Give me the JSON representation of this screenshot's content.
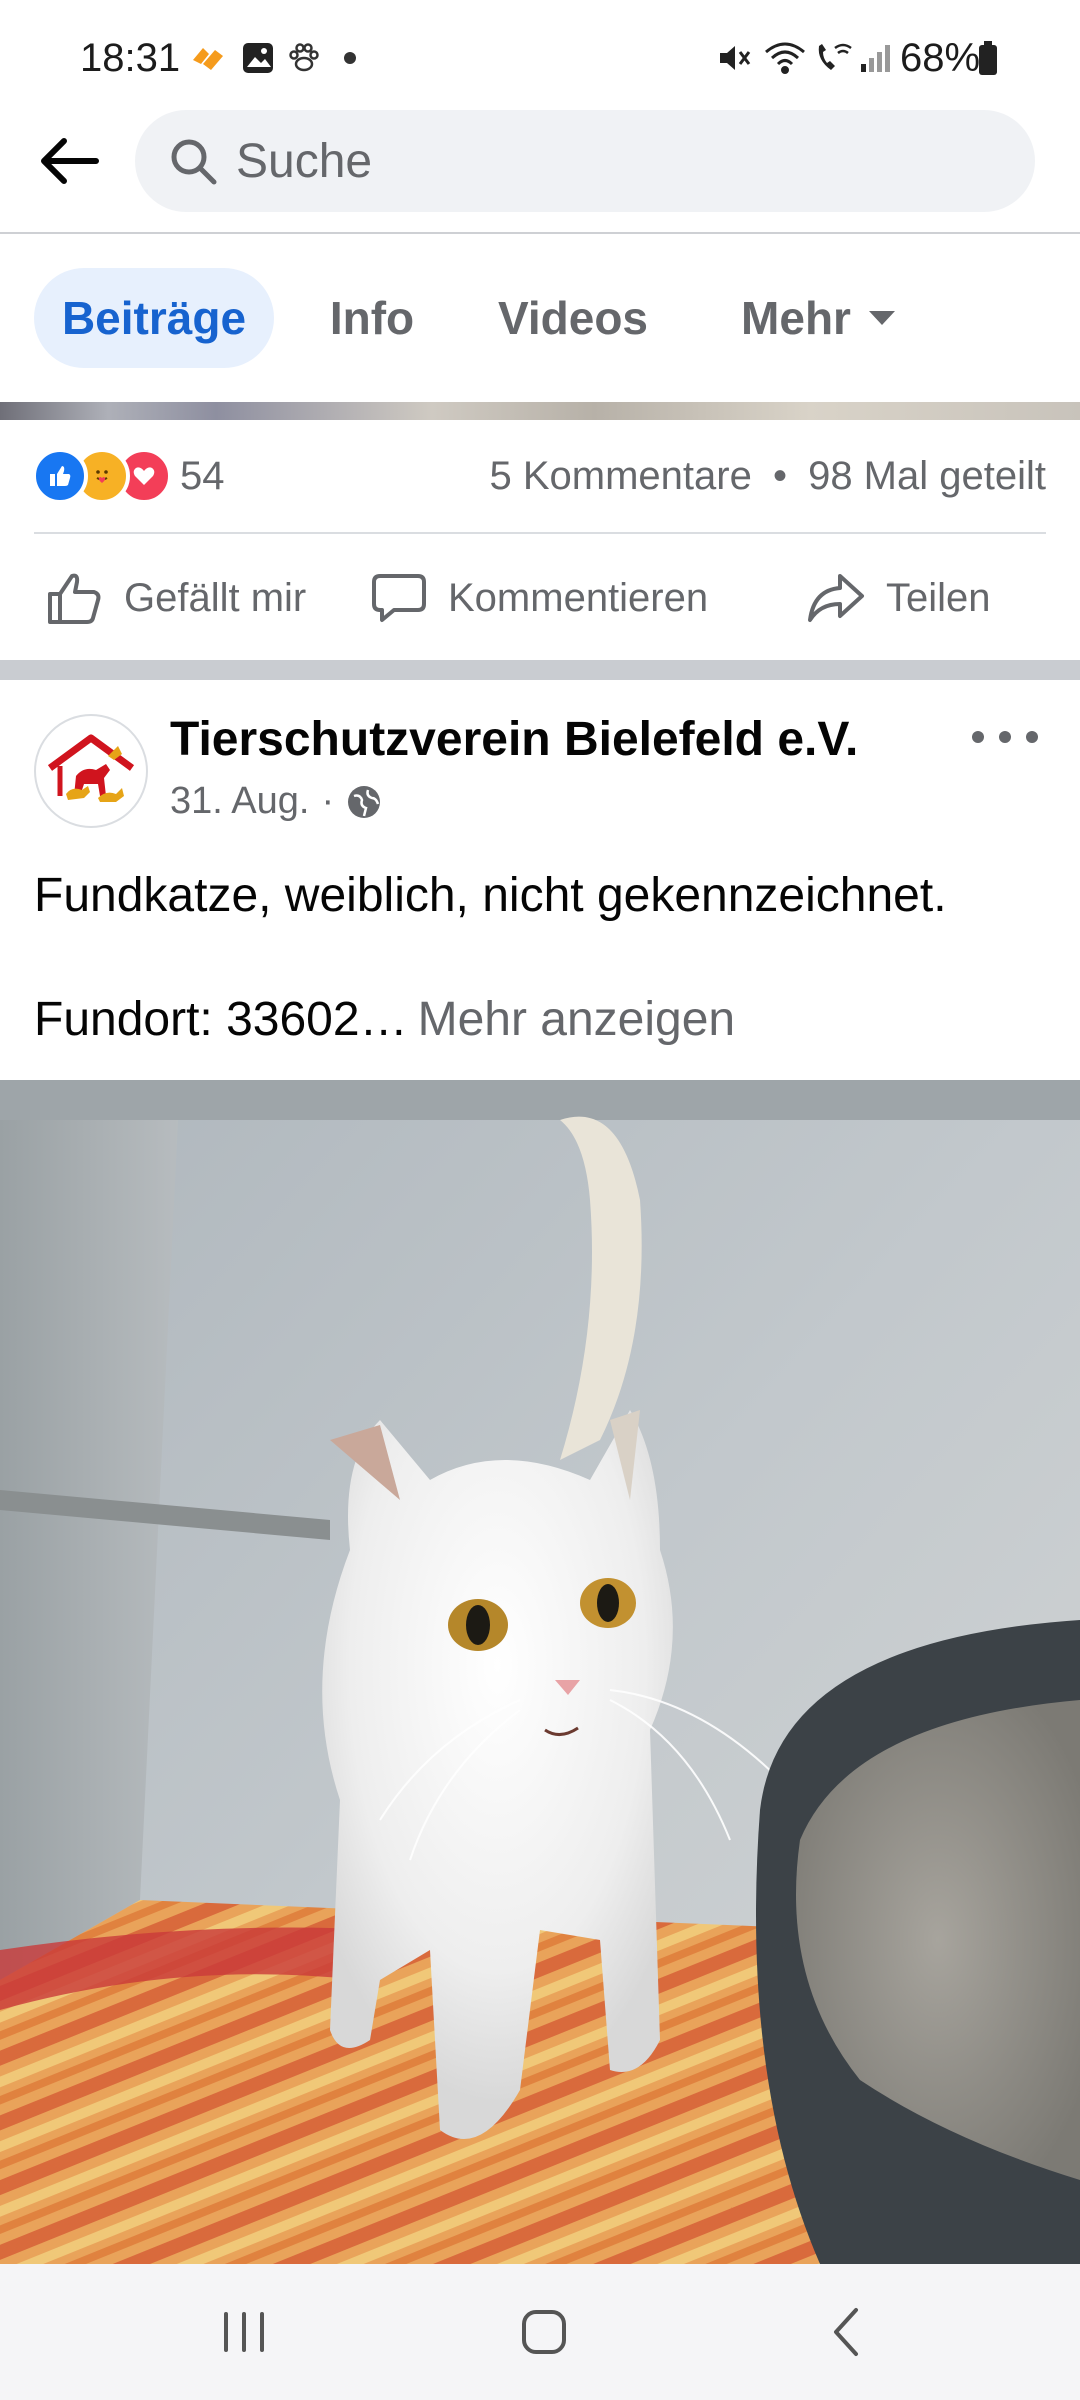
{
  "status_bar": {
    "time": "18:31",
    "battery": "68%",
    "left_icons": [
      "app-notification-icon",
      "gallery-icon",
      "paw-icon",
      "dot-icon"
    ],
    "right_icons": [
      "mute-icon",
      "wifi-icon",
      "wifi-calling-icon",
      "signal-icon",
      "battery-icon"
    ]
  },
  "header": {
    "search_placeholder": "Suche"
  },
  "tabs": [
    {
      "label": "Beiträge",
      "active": true
    },
    {
      "label": "Info",
      "active": false
    },
    {
      "label": "Videos",
      "active": false
    },
    {
      "label": "Mehr",
      "active": false
    }
  ],
  "previous_post": {
    "reaction_count": "54",
    "comments": "5 Kommentare",
    "separator": "•",
    "shares": "98 Mal geteilt",
    "actions": {
      "like": "Gefällt mir",
      "comment": "Kommentieren",
      "share": "Teilen"
    }
  },
  "post": {
    "author": "Tierschutzverein Bielefeld e.V.",
    "date": "31. Aug.",
    "date_separator": "·",
    "line1": "Fundkatze, weiblich, nicht gekennzeichnet.",
    "line2": "Fundort: 33602…",
    "see_more": "Mehr anzeigen"
  },
  "colors": {
    "facebook_blue": "#1877f2",
    "tab_active_bg": "#e7f0fd",
    "tab_active_text": "#1763cf",
    "secondary_text": "#65676b"
  }
}
